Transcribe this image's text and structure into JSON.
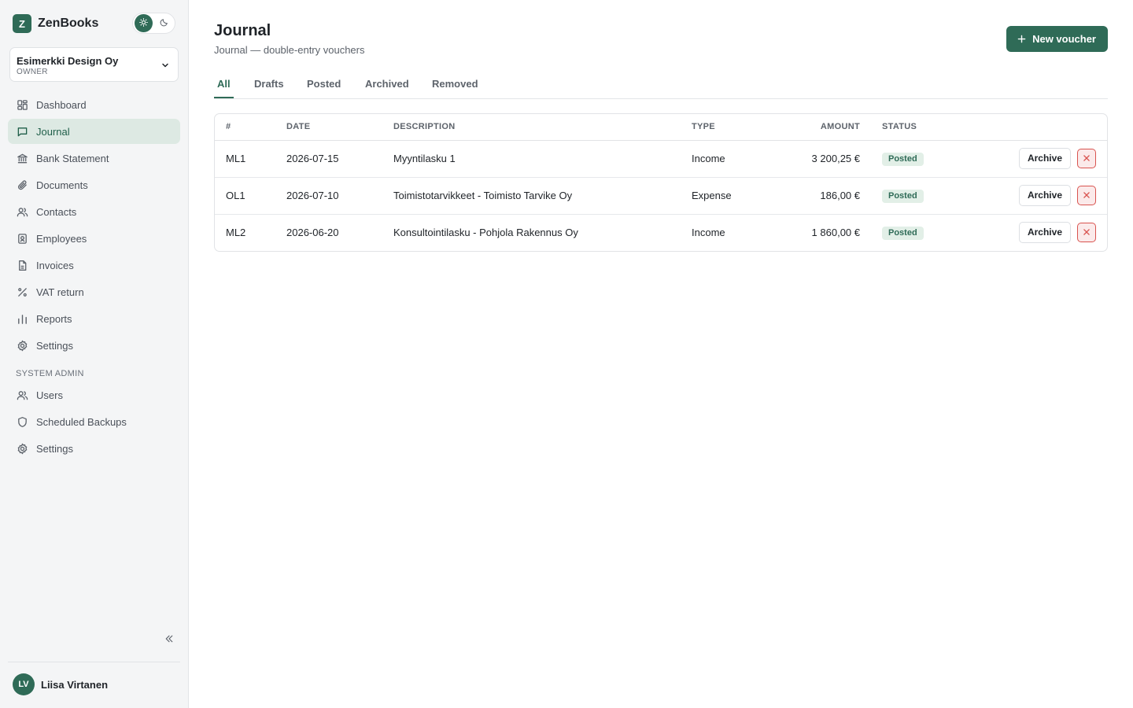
{
  "app": {
    "logo_letter": "Z",
    "name": "ZenBooks"
  },
  "theme": {
    "light_icon": "sun-icon",
    "dark_icon": "moon-icon",
    "active": "light"
  },
  "company": {
    "name": "Esimerkki Design Oy",
    "role": "OWNER"
  },
  "nav": {
    "items": [
      {
        "label": "Dashboard",
        "icon": "dashboard-icon",
        "active": false
      },
      {
        "label": "Journal",
        "icon": "journal-icon",
        "active": true
      },
      {
        "label": "Bank Statement",
        "icon": "bank-icon",
        "active": false
      },
      {
        "label": "Documents",
        "icon": "paperclip-icon",
        "active": false
      },
      {
        "label": "Contacts",
        "icon": "contacts-icon",
        "active": false
      },
      {
        "label": "Employees",
        "icon": "employee-badge-icon",
        "active": false
      },
      {
        "label": "Invoices",
        "icon": "document-icon",
        "active": false
      },
      {
        "label": "VAT return",
        "icon": "percent-icon",
        "active": false
      },
      {
        "label": "Reports",
        "icon": "bar-chart-icon",
        "active": false
      },
      {
        "label": "Settings",
        "icon": "gear-icon",
        "active": false
      }
    ],
    "admin_section": "SYSTEM ADMIN",
    "admin_items": [
      {
        "label": "Users",
        "icon": "users-icon"
      },
      {
        "label": "Scheduled Backups",
        "icon": "shield-icon"
      },
      {
        "label": "Settings",
        "icon": "gear-icon"
      }
    ]
  },
  "user": {
    "initials": "LV",
    "name": "Liisa Virtanen"
  },
  "page": {
    "title": "Journal",
    "subtitle": "Journal — double-entry vouchers",
    "new_button": "New voucher"
  },
  "tabs": [
    {
      "label": "All",
      "active": true
    },
    {
      "label": "Drafts",
      "active": false
    },
    {
      "label": "Posted",
      "active": false
    },
    {
      "label": "Archived",
      "active": false
    },
    {
      "label": "Removed",
      "active": false
    }
  ],
  "table": {
    "columns": [
      "#",
      "DATE",
      "DESCRIPTION",
      "TYPE",
      "AMOUNT",
      "STATUS"
    ],
    "rows": [
      {
        "id": "ML1",
        "date": "2026-07-15",
        "description": "Myyntilasku 1",
        "type": "Income",
        "amount": "3 200,25 €",
        "status": "Posted",
        "archive": "Archive"
      },
      {
        "id": "OL1",
        "date": "2026-07-10",
        "description": "Toimistotarvikkeet - Toimisto Tarvike Oy",
        "type": "Expense",
        "amount": "186,00 €",
        "status": "Posted",
        "archive": "Archive"
      },
      {
        "id": "ML2",
        "date": "2026-06-20",
        "description": "Konsultointilasku - Pohjola Rakennus Oy",
        "type": "Income",
        "amount": "1 860,00 €",
        "status": "Posted",
        "archive": "Archive"
      }
    ]
  },
  "colors": {
    "accent": "#2f6b57",
    "active_nav_bg": "#dde9e3",
    "badge_bg": "#e2efe7",
    "danger": "#d9534f"
  }
}
